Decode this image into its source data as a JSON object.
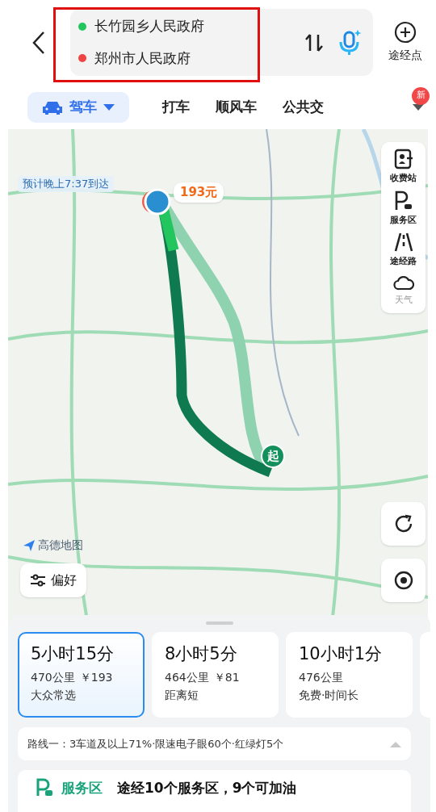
{
  "waypoints": [
    {
      "label": "长竹园乡人民政府",
      "color": "#22c55e"
    },
    {
      "label": "郑州市人民政府",
      "color": "#ef4444"
    }
  ],
  "add_stop": {
    "label": "途经点"
  },
  "modes": [
    {
      "label": "驾车",
      "selected": true
    },
    {
      "label": "打车",
      "selected": false
    },
    {
      "label": "顺风车",
      "selected": false
    },
    {
      "label": "公共交",
      "selected": false
    }
  ],
  "new_badge": "新",
  "map": {
    "eta": "预计晚上7:37到达",
    "toll": "193元",
    "start_marker": "起",
    "logo": "高德地图",
    "preference": "偏好",
    "tools": [
      {
        "label": "收费站",
        "kind": "toll"
      },
      {
        "label": "服务区",
        "kind": "service"
      },
      {
        "label": "途经路",
        "kind": "road"
      },
      {
        "label": "天气",
        "kind": "weather"
      }
    ]
  },
  "routes": [
    {
      "duration": "5小时15分",
      "distance": "470公里",
      "price": "￥193",
      "tag": "大众常选",
      "selected": true
    },
    {
      "duration": "8小时5分",
      "distance": "464公里",
      "price": "￥81",
      "tag": "距离短",
      "selected": false
    },
    {
      "duration": "10小时1分",
      "distance": "476公里",
      "tag": "免费·时间长",
      "selected": false
    }
  ],
  "route_info": "路线一：3车道及以上71%·限速电子眼60个·红绿灯5个",
  "service": {
    "label": "服务区",
    "text": "途经10个服务区，9个可加油"
  }
}
